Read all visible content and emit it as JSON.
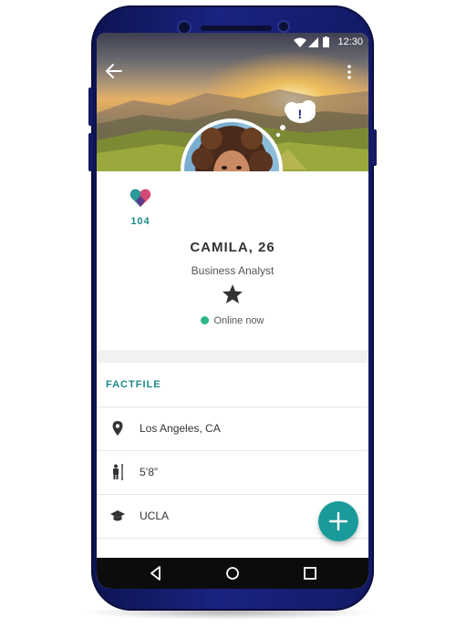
{
  "status_bar": {
    "time": "12:30"
  },
  "profile": {
    "score": "104",
    "name": "CAMILA, 26",
    "job": "Business Analyst",
    "online_status": "Online now"
  },
  "factfile": {
    "title": "FACTFILE",
    "items": [
      {
        "icon": "location-pin-icon",
        "label": "Los Angeles, CA"
      },
      {
        "icon": "height-icon",
        "label": "5’8”"
      },
      {
        "icon": "graduation-cap-icon",
        "label": "UCLA"
      }
    ]
  },
  "colors": {
    "accent": "#1a8a8a",
    "fab": "#1a9a9a",
    "online": "#2cb589",
    "phone_body": "#1a2380"
  },
  "icons": {
    "back": "arrow-left-icon",
    "menu": "more-vert-icon",
    "like": "thumbs-up-icon",
    "thought": "thought-bubble-alert-icon",
    "favourite": "star-icon",
    "score": "heart-icon",
    "fab": "plus-icon"
  }
}
